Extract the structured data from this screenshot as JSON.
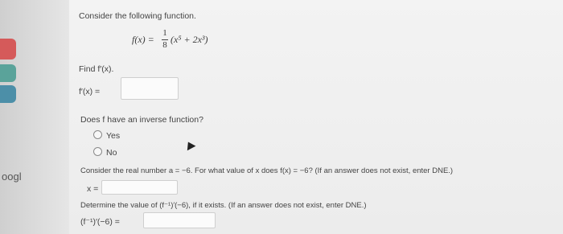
{
  "sidebar": {
    "partial_word": "oogl"
  },
  "question": {
    "prompt": "Consider the following function.",
    "function_lhs": "f(x) =",
    "frac_num": "1",
    "frac_den": "8",
    "function_rhs": "(x⁵ + 2x³)",
    "part1_label": "Find f′(x).",
    "part1_input_label": "f′(x) =",
    "part1_value": "",
    "part2_label": "Does f have an inverse function?",
    "options": [
      "Yes",
      "No"
    ],
    "part3_label": "Consider the real number a = −6. For what value of x does f(x) = −6? (If an answer does not exist, enter DNE.)",
    "part3_input_label": "x =",
    "part3_value": "",
    "part4_label": "Determine the value of (f⁻¹)′(−6), if it exists. (If an answer does not exist, enter DNE.)",
    "part4_input_label": "(f⁻¹)′(−6) =",
    "part4_value": ""
  }
}
